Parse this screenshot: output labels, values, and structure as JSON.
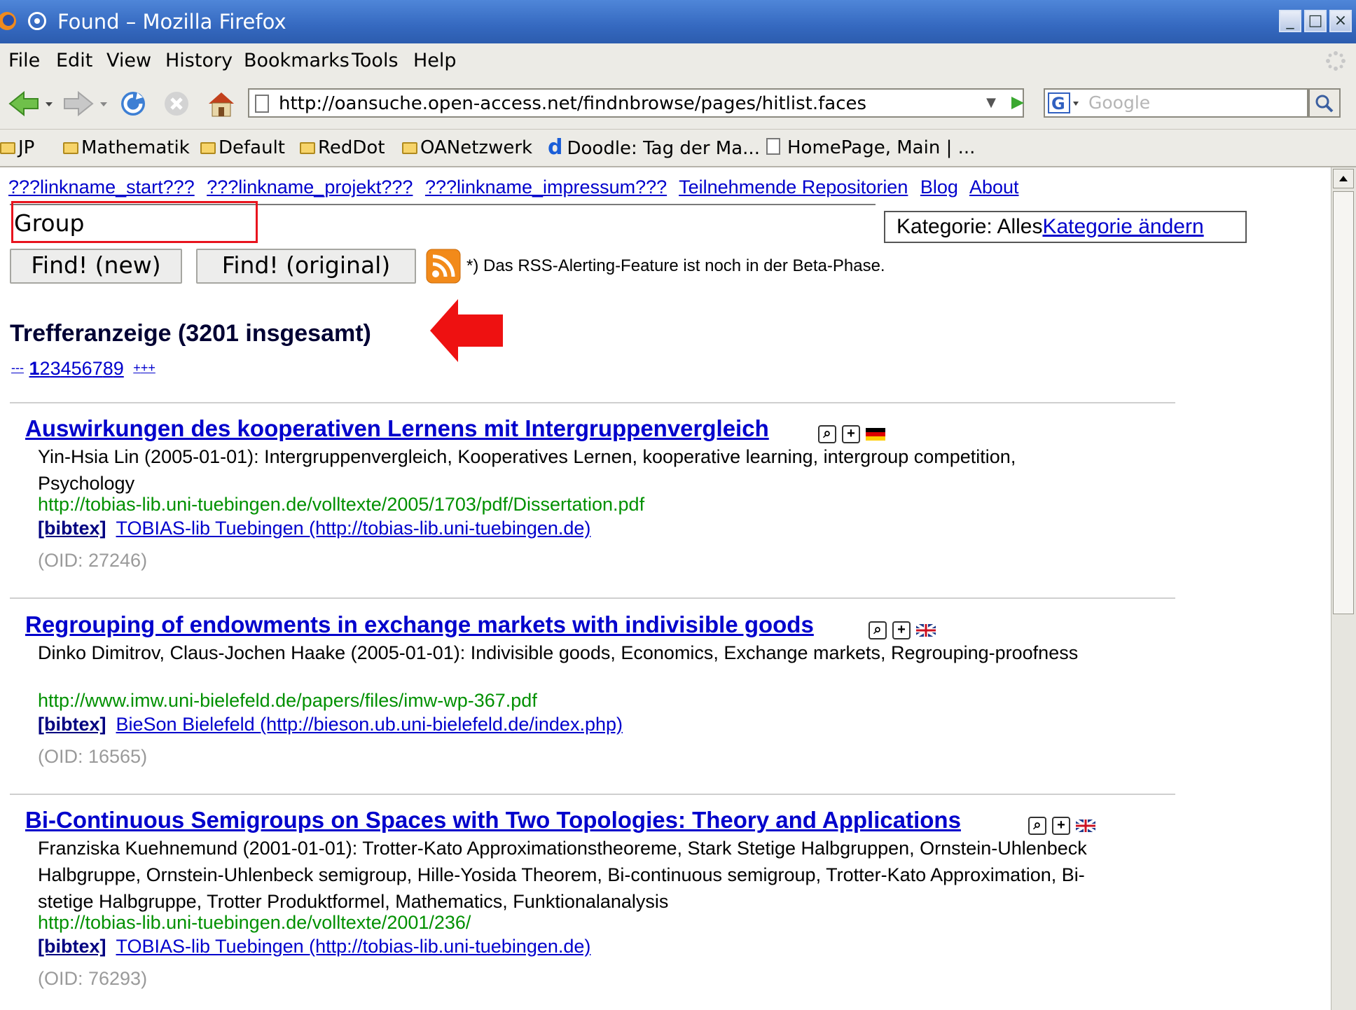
{
  "window": {
    "title": "Found – Mozilla Firefox",
    "buttons": [
      "_",
      "□",
      "×"
    ]
  },
  "menubar": {
    "items": [
      {
        "label": "File"
      },
      {
        "label": "Edit"
      },
      {
        "label": "View"
      },
      {
        "label": "History"
      },
      {
        "label": "Bookmarks"
      },
      {
        "label": "Tools"
      },
      {
        "label": "Help"
      }
    ]
  },
  "toolbar": {
    "icons": [
      "back-icon",
      "forward-icon",
      "reload-icon",
      "stop-icon",
      "home-icon"
    ],
    "url": "http://oansuche.open-access.net/findnbrowse/pages/hitlist.faces",
    "search_placeholder": "Google"
  },
  "bookmarks": [
    {
      "label": "JP",
      "icon": "folder-icon"
    },
    {
      "label": "Mathematik",
      "icon": "folder-icon"
    },
    {
      "label": "Default",
      "icon": "folder-icon"
    },
    {
      "label": "RedDot",
      "icon": "folder-icon"
    },
    {
      "label": "OANetzwerk",
      "icon": "folder-icon"
    },
    {
      "label": "Doodle: Tag der Ma...",
      "icon": "doodle-icon"
    },
    {
      "label": "HomePage, Main | ...",
      "icon": "page-icon"
    }
  ],
  "page": {
    "top_links": [
      "???linkname_start???",
      "???linkname_projekt???",
      "???linkname_impressum???",
      "Teilnehmende Repositorien",
      "Blog",
      "About"
    ],
    "query_value": "Group",
    "category_label": "Kategorie: Alles",
    "category_change": "Kategorie ändern",
    "find_new": "Find! (new)",
    "find_original": "Find! (original)",
    "rss_note": "*) Das RSS-Alerting-Feature ist noch in der Beta-Phase.",
    "hits_title": "Trefferanzeige (3201 insgesamt)",
    "pager": {
      "first": "---",
      "pages": [
        "1",
        "2",
        "3",
        "4",
        "5",
        "6",
        "7",
        "8",
        "9"
      ],
      "current": "1",
      "next": "+",
      "last": "++"
    },
    "bibtex_label": "[bibtex]",
    "results": [
      {
        "title": "Auswirkungen des kooperativen Lernens mit Intergruppenvergleich",
        "flag": "de",
        "meta": "Yin-Hsia Lin (2005-01-01):  Intergruppenvergleich, Kooperatives Lernen, kooperative learning, intergroup competition, Psychology",
        "url": "http://tobias-lib.uni-tuebingen.de/volltexte/2005/1703/pdf/Dissertation.pdf",
        "repo": "TOBIAS-lib Tuebingen (http://tobias-lib.uni-tuebingen.de)",
        "oid": "(OID: 27246)"
      },
      {
        "title": "Regrouping of endowments in exchange markets with indivisible goods",
        "flag": "uk",
        "meta": "Dinko Dimitrov, Claus-Jochen Haake (2005-01-01):  Indivisible goods, Economics, Exchange markets, Regrouping-proofness",
        "url": "http://www.imw.uni-bielefeld.de/papers/files/imw-wp-367.pdf",
        "repo": "BieSon Bielefeld (http://bieson.ub.uni-bielefeld.de/index.php)",
        "oid": "(OID: 16565)"
      },
      {
        "title": "Bi-Continuous Semigroups on Spaces with Two Topologies: Theory and Applications",
        "flag": "uk",
        "meta": "Franziska Kuehnemund (2001-01-01):  Trotter-Kato Approximationstheoreme, Stark Stetige Halbgruppen, Ornstein-Uhlenbeck Halbgruppe, Ornstein-Uhlenbeck semigroup, Hille-Yosida Theorem, Bi-continuous semigroup, Trotter-Kato Approximation, Bi-stetige Halbgruppe, Trotter Produktformel, Mathematics, Funktionalanalysis",
        "url": "http://tobias-lib.uni-tuebingen.de/volltexte/2001/236/",
        "repo": "TOBIAS-lib Tuebingen (http://tobias-lib.uni-tuebingen.de)",
        "oid": "(OID: 76293)"
      }
    ]
  }
}
